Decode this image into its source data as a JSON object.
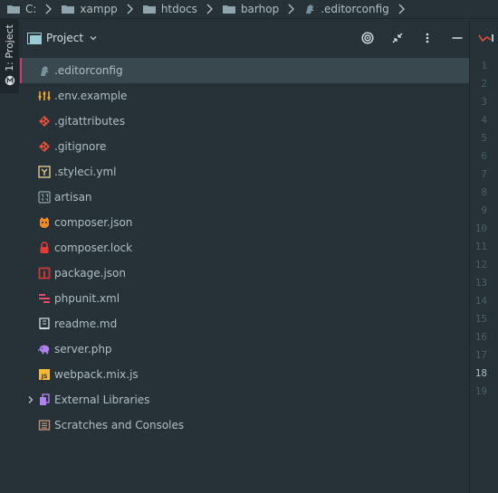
{
  "breadcrumb": [
    {
      "label": "C:",
      "icon": "folder-icon"
    },
    {
      "label": "xampp",
      "icon": "folder-icon"
    },
    {
      "label": "htdocs",
      "icon": "folder-icon"
    },
    {
      "label": "barhop",
      "icon": "folder-icon"
    },
    {
      "label": ".editorconfig",
      "icon": "editorconfig-file-icon"
    }
  ],
  "left_tab": {
    "label": "1: Project"
  },
  "project_panel": {
    "title": "Project",
    "actions": [
      "locate-file-icon",
      "collapse-all-icon",
      "options-menu-icon",
      "hide-panel-icon"
    ]
  },
  "tree": [
    {
      "label": ".editorconfig",
      "icon": "editorconfig-icon",
      "selected": true
    },
    {
      "label": ".env.example",
      "icon": "env-settings-icon"
    },
    {
      "label": ".gitattributes",
      "icon": "git-icon"
    },
    {
      "label": ".gitignore",
      "icon": "git-icon"
    },
    {
      "label": ".styleci.yml",
      "icon": "yaml-icon"
    },
    {
      "label": "artisan",
      "icon": "binary-file-icon"
    },
    {
      "label": "composer.json",
      "icon": "composer-icon"
    },
    {
      "label": "composer.lock",
      "icon": "lock-icon"
    },
    {
      "label": "package.json",
      "icon": "npm-icon"
    },
    {
      "label": "phpunit.xml",
      "icon": "xml-icon"
    },
    {
      "label": "readme.md",
      "icon": "markdown-icon"
    },
    {
      "label": "server.php",
      "icon": "php-elephant-icon"
    },
    {
      "label": "webpack.mix.js",
      "icon": "javascript-icon"
    },
    {
      "label": "External Libraries",
      "icon": "library-icon",
      "expandable": true
    },
    {
      "label": "Scratches and Consoles",
      "icon": "scratches-icon"
    }
  ],
  "line_numbers": [
    "1",
    "2",
    "3",
    "4",
    "5",
    "6",
    "7",
    "8",
    "9",
    "10",
    "11",
    "12",
    "13",
    "14",
    "15",
    "16",
    "17",
    "18",
    "19"
  ],
  "current_line": "18",
  "colors": {
    "background": "#263238",
    "selection": "#39474f",
    "accent": "#cf3a6e"
  }
}
